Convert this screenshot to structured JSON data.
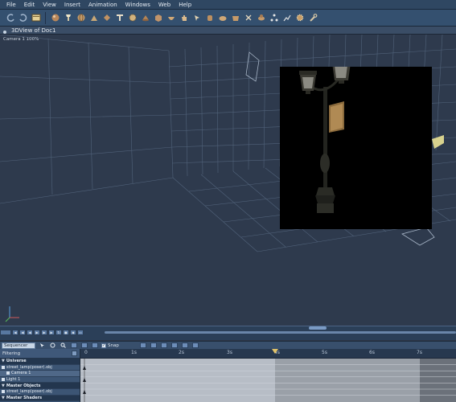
{
  "menu": [
    "File",
    "Edit",
    "View",
    "Insert",
    "Animation",
    "Windows",
    "Web",
    "Help"
  ],
  "toolbar": {
    "icons": [
      "undo-icon",
      "redo-icon",
      "scroll-tool-icon",
      "sphere-icon",
      "spotlight-icon",
      "globe-icon",
      "sculpt-icon",
      "ring-icon",
      "text-tool-icon",
      "gear-shape-icon",
      "cone-icon",
      "cube-icon",
      "bowl-icon",
      "hand-icon",
      "pointer-icon",
      "jar-icon",
      "funnel-icon",
      "bucket-icon",
      "scissor-icon",
      "blob-icon",
      "nodes-icon",
      "chart-icon",
      "gear-icon",
      "wrench-icon"
    ]
  },
  "viewport": {
    "title": "3DView of Doc1",
    "camera_label": "Camera 1 100%"
  },
  "timeline": {
    "controls": [
      "rewind",
      "step-back",
      "play-back",
      "play",
      "step-forward",
      "fast-forward",
      "loop",
      "record",
      "key",
      "trash"
    ]
  },
  "sequencer": {
    "mode": "Sequencer",
    "snap_label": "Snap",
    "filtering_label": "Filtering",
    "ruler": [
      "0",
      "1s",
      "2s",
      "3s",
      "4s",
      "5s",
      "6s",
      "7s"
    ],
    "tree": [
      {
        "label": "Universe",
        "type": "header"
      },
      {
        "label": "street_lamp(poser).obj",
        "type": "item"
      },
      {
        "label": "Camera 1",
        "type": "sub"
      },
      {
        "label": "Light 1",
        "type": "item"
      },
      {
        "label": "Master Objects",
        "type": "header"
      },
      {
        "label": "street_lamp(poser).obj",
        "type": "item"
      },
      {
        "label": "Master Shaders",
        "type": "header"
      }
    ]
  },
  "colors": {
    "menubar": "#2f4762",
    "viewport_bg": "#2e3a4d",
    "grid_line": "#5a6d86",
    "render_bg": "#000000"
  }
}
